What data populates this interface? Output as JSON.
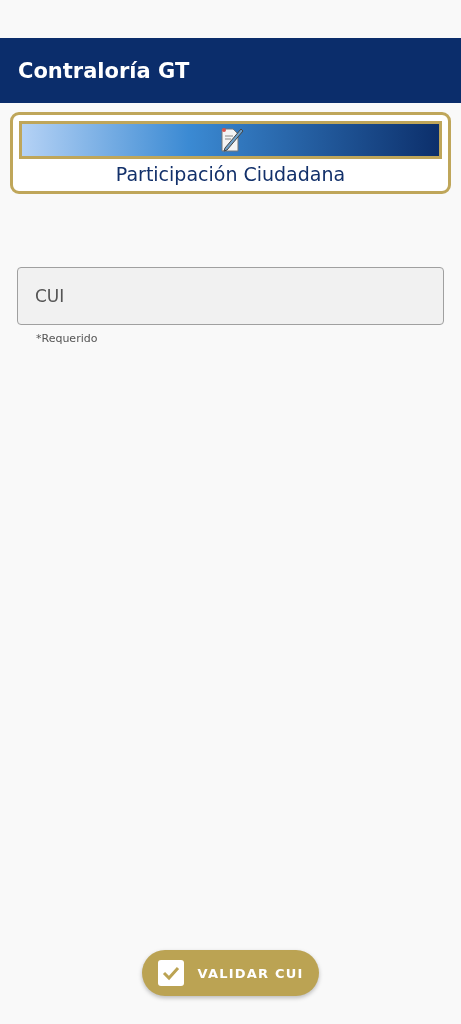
{
  "app_bar": {
    "title": "Contraloría GT"
  },
  "banner": {
    "title": "Participación Ciudadana"
  },
  "cui_field": {
    "placeholder": "CUI",
    "helper": "*Requerido"
  },
  "validate_button": {
    "label": "VALIDAR CUI"
  }
}
